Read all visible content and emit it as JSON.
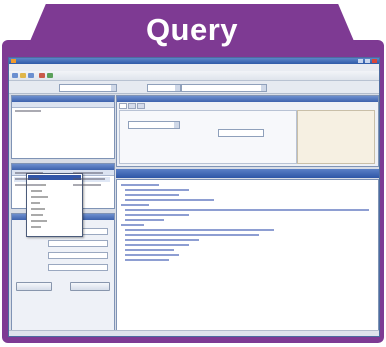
{
  "header": {
    "title": "Query"
  },
  "window": {
    "title": "",
    "menu": [
      "",
      "",
      "",
      "",
      ""
    ],
    "address": {
      "label": "",
      "value": ""
    }
  },
  "left_panel": {
    "tree_title": "",
    "tree_items": [
      ""
    ],
    "grid_title": "",
    "grid_rows": [
      {
        "name": "",
        "type": ""
      },
      {
        "name": "",
        "type": ""
      },
      {
        "name": "",
        "type": ""
      },
      {
        "name": "",
        "type": ""
      }
    ],
    "props_title": "",
    "fields": [
      {
        "label": "",
        "value": ""
      },
      {
        "label": "",
        "value": ""
      },
      {
        "label": "",
        "value": ""
      },
      {
        "label": "",
        "value": ""
      }
    ],
    "buttons": [
      "",
      ""
    ]
  },
  "right_panel": {
    "tabs": [
      "",
      "",
      ""
    ],
    "dropdown_items": [
      "",
      "",
      "",
      "",
      "",
      "",
      "",
      "",
      "",
      ""
    ],
    "editor_title": "",
    "code_lines": [
      "",
      "",
      "",
      "",
      "",
      "",
      "",
      "",
      "",
      "",
      "",
      "",
      "",
      "",
      "",
      "",
      ""
    ]
  },
  "colors": {
    "brand_purple": "#7e3a93",
    "title_bar_blue": "#2f5aa8",
    "selection_blue": "#3156a8"
  }
}
